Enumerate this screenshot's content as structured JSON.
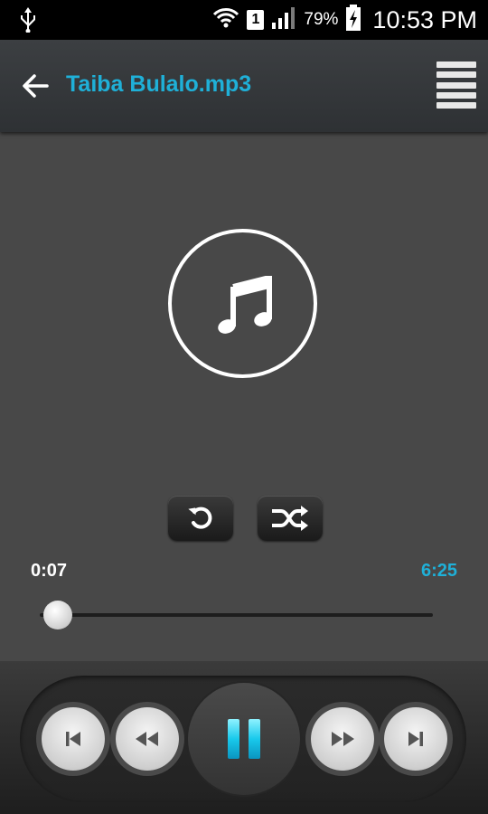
{
  "status_bar": {
    "sim_slot": "1",
    "battery_percent": "79%",
    "time": "10:53 PM",
    "icons": [
      "usb-icon",
      "wifi-icon",
      "signal-icon",
      "battery-charging-icon"
    ]
  },
  "toolbar": {
    "title": "Taiba Bulalo.mp3",
    "back_icon": "back-arrow-icon",
    "menu_icon": "menu-icon"
  },
  "player": {
    "album_art_icon": "music-note-icon",
    "repeat_icon": "repeat-icon",
    "shuffle_icon": "shuffle-icon",
    "current_time": "0:07",
    "total_time": "6:25",
    "progress_fraction": 0.018
  },
  "transport": {
    "icons": [
      "skip-previous-icon",
      "rewind-icon",
      "pause-icon",
      "fast-forward-icon",
      "skip-next-icon"
    ]
  },
  "colors": {
    "accent": "#1fb0d8",
    "background": "#484848",
    "toolbar": "#333639"
  }
}
